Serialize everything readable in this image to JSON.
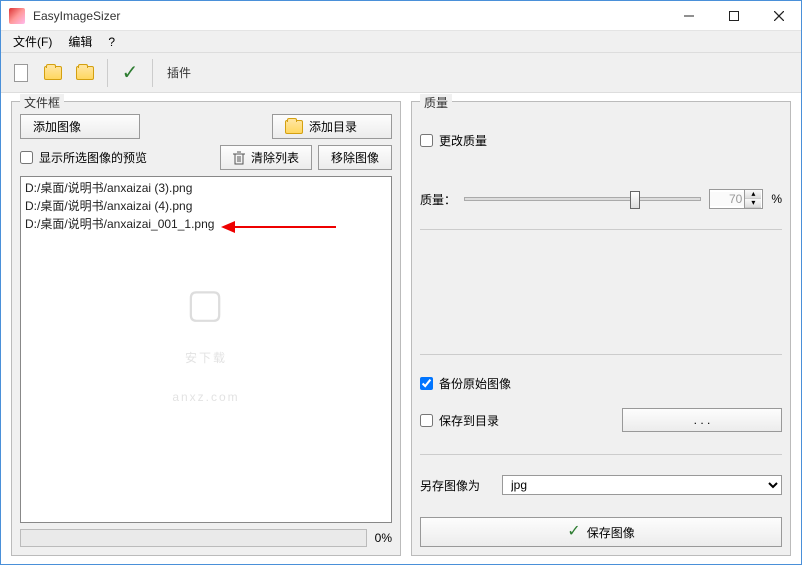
{
  "window": {
    "title": "EasyImageSizer"
  },
  "menu": {
    "file": "文件(F)",
    "edit": "编辑",
    "help": "?"
  },
  "toolbar": {
    "plugin_label": "插件"
  },
  "left": {
    "panel_title": "文件框",
    "add_image": "添加图像",
    "add_folder": "添加目录",
    "preview_checkbox": "显示所选图像的预览",
    "clear_list": "清除列表",
    "remove_image": "移除图像",
    "files": [
      "D:/桌面/说明书/anxaizai (3).png",
      "D:/桌面/说明书/anxaizai (4).png",
      "D:/桌面/说明书/anxaizai_001_1.png"
    ],
    "progress_pct": "0%"
  },
  "right": {
    "panel_title": "质量",
    "change_quality": "更改质量",
    "quality_label": "质量：",
    "quality_value": "70",
    "quality_unit": "%",
    "backup_original": "备份原始图像",
    "save_to_dir": "保存到目录",
    "browse_btn": ". . .",
    "save_as_label": "另存图像为",
    "format_selected": "jpg",
    "save_image_btn": "保存图像"
  },
  "watermark": {
    "line1": "安下载",
    "line2": "anxz.com"
  }
}
